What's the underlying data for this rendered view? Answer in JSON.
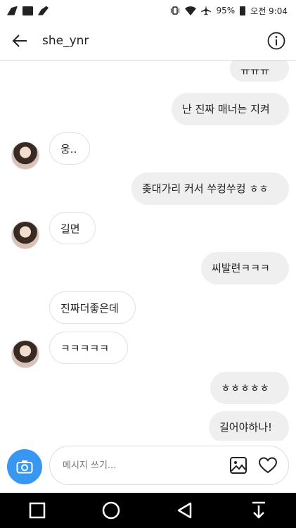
{
  "status_bar": {
    "battery": "95%",
    "time": "오전 9:04"
  },
  "header": {
    "username": "she_ynr",
    "back_icon": "arrow-left-icon",
    "info_icon": "info-circle-icon"
  },
  "messages": [
    {
      "from": "me",
      "text": "ㅠㅠㅠ"
    },
    {
      "from": "me",
      "text": "난 진짜 매너는 지켜"
    },
    {
      "from": "them",
      "text": "웅.."
    },
    {
      "from": "me",
      "text": "좆대가리 커서 쑤컹쑤컹 ㅎㅎ"
    },
    {
      "from": "them",
      "text": "길면"
    },
    {
      "from": "me",
      "text": "씨발련ㅋㅋㅋ"
    },
    {
      "from": "them",
      "text": "진짜더좋은데"
    },
    {
      "from": "them",
      "text": "ㅋㅋㅋㅋㅋ"
    },
    {
      "from": "me",
      "text": "ㅎㅎㅎㅎㅎ"
    },
    {
      "from": "me",
      "text": "길어야하나!"
    }
  ],
  "composer": {
    "placeholder": "메시지 쓰기...",
    "camera_icon": "camera-icon",
    "gallery_icon": "image-icon",
    "like_icon": "heart-icon"
  },
  "colors": {
    "accent": "#3897f0",
    "sent_bubble": "#efefef",
    "nav_bar": "#000000"
  }
}
